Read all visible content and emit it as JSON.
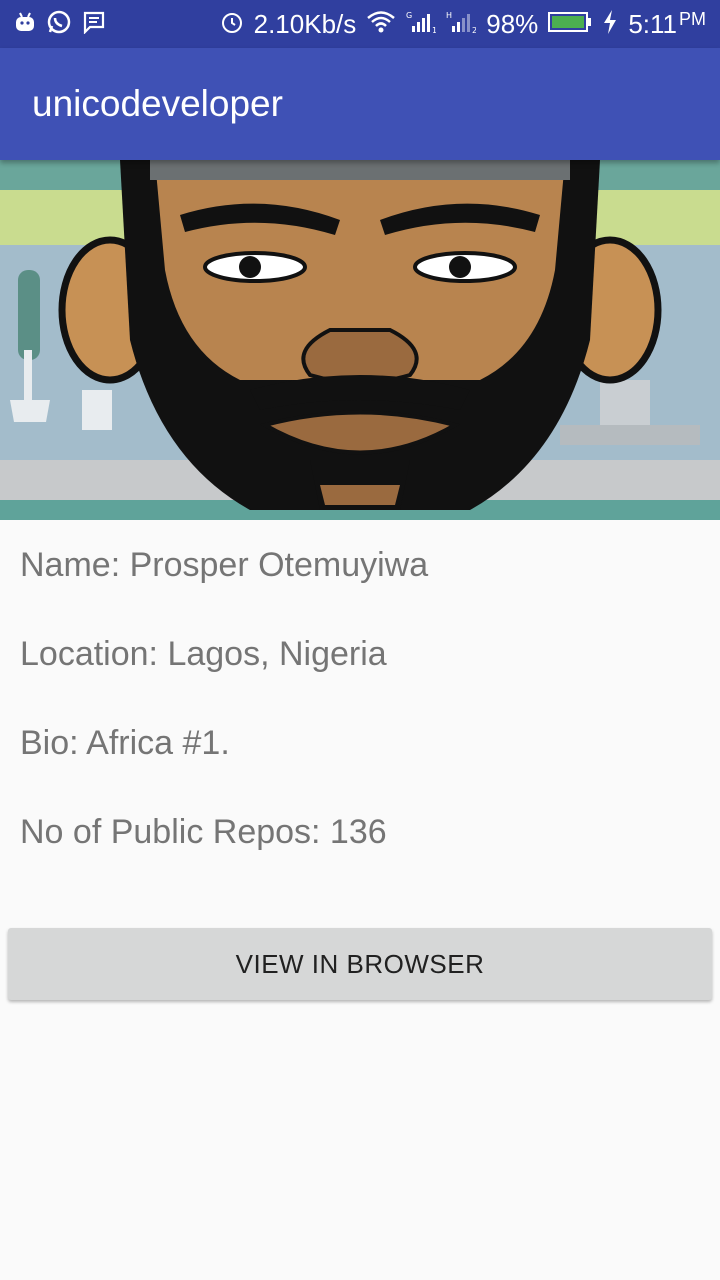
{
  "status_bar": {
    "speed": "2.10Kb/s",
    "battery": "98%",
    "time": "5:11",
    "ampm": "PM",
    "icons": [
      "android-notification-icon",
      "whatsapp-icon",
      "message-icon",
      "alarm-icon",
      "wifi-icon",
      "signal-icon",
      "signal-icon-2",
      "battery-icon",
      "charging-icon"
    ]
  },
  "app_bar": {
    "title": "unicodeveloper"
  },
  "profile": {
    "name": "Name: Prosper Otemuyiwa",
    "location": "Location: Lagos, Nigeria",
    "bio": "Bio: Africa #1.",
    "repos": "No of Public Repos: 136"
  },
  "actions": {
    "view_browser": "VIEW IN BROWSER"
  },
  "colors": {
    "status_bar": "#303f9f",
    "app_bar": "#3f51b5",
    "button": "#d6d7d7",
    "text": "#757575"
  }
}
